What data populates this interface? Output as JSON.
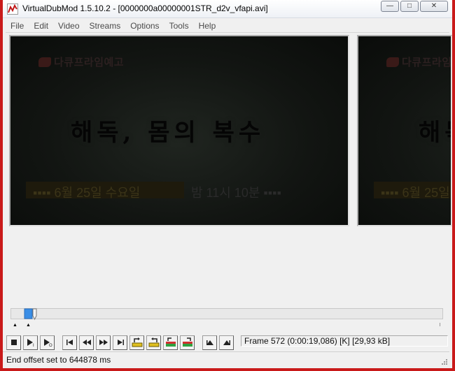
{
  "window": {
    "title": "VirtualDubMod 1.5.10.2 - [0000000a00000001STR_d2v_vfapi.avi]",
    "caption_buttons": {
      "minimize": "—",
      "maximize": "□",
      "close": "✕"
    }
  },
  "menu": [
    "File",
    "Edit",
    "Video",
    "Streams",
    "Options",
    "Tools",
    "Help"
  ],
  "video": {
    "logo_text": "다큐프라임예고",
    "headline": "해독, 몸의 복수",
    "air_date": "▪▪▪▪ 6월 25일 수요일",
    "air_time": "밤 11시 10분 ▪▪▪▪"
  },
  "toolbar": {
    "buttons": [
      "stop-icon",
      "play-input-icon",
      "play-output-icon",
      "go-start-icon",
      "step-back-icon",
      "step-forward-icon",
      "go-end-icon",
      "prev-keyframe-icon",
      "next-keyframe-icon",
      "scene-back-icon",
      "scene-forward-icon",
      "mark-in-icon",
      "mark-out-icon"
    ],
    "frame_info": "Frame 572 (0:00:19,086) [K] [29,93 kB]"
  },
  "timeline": {
    "position_fraction": 0.04
  },
  "status": {
    "message": "End offset set to 644878 ms"
  },
  "colors": {
    "window_border": "#c91a1a",
    "thumb": "#3a8ee6"
  }
}
